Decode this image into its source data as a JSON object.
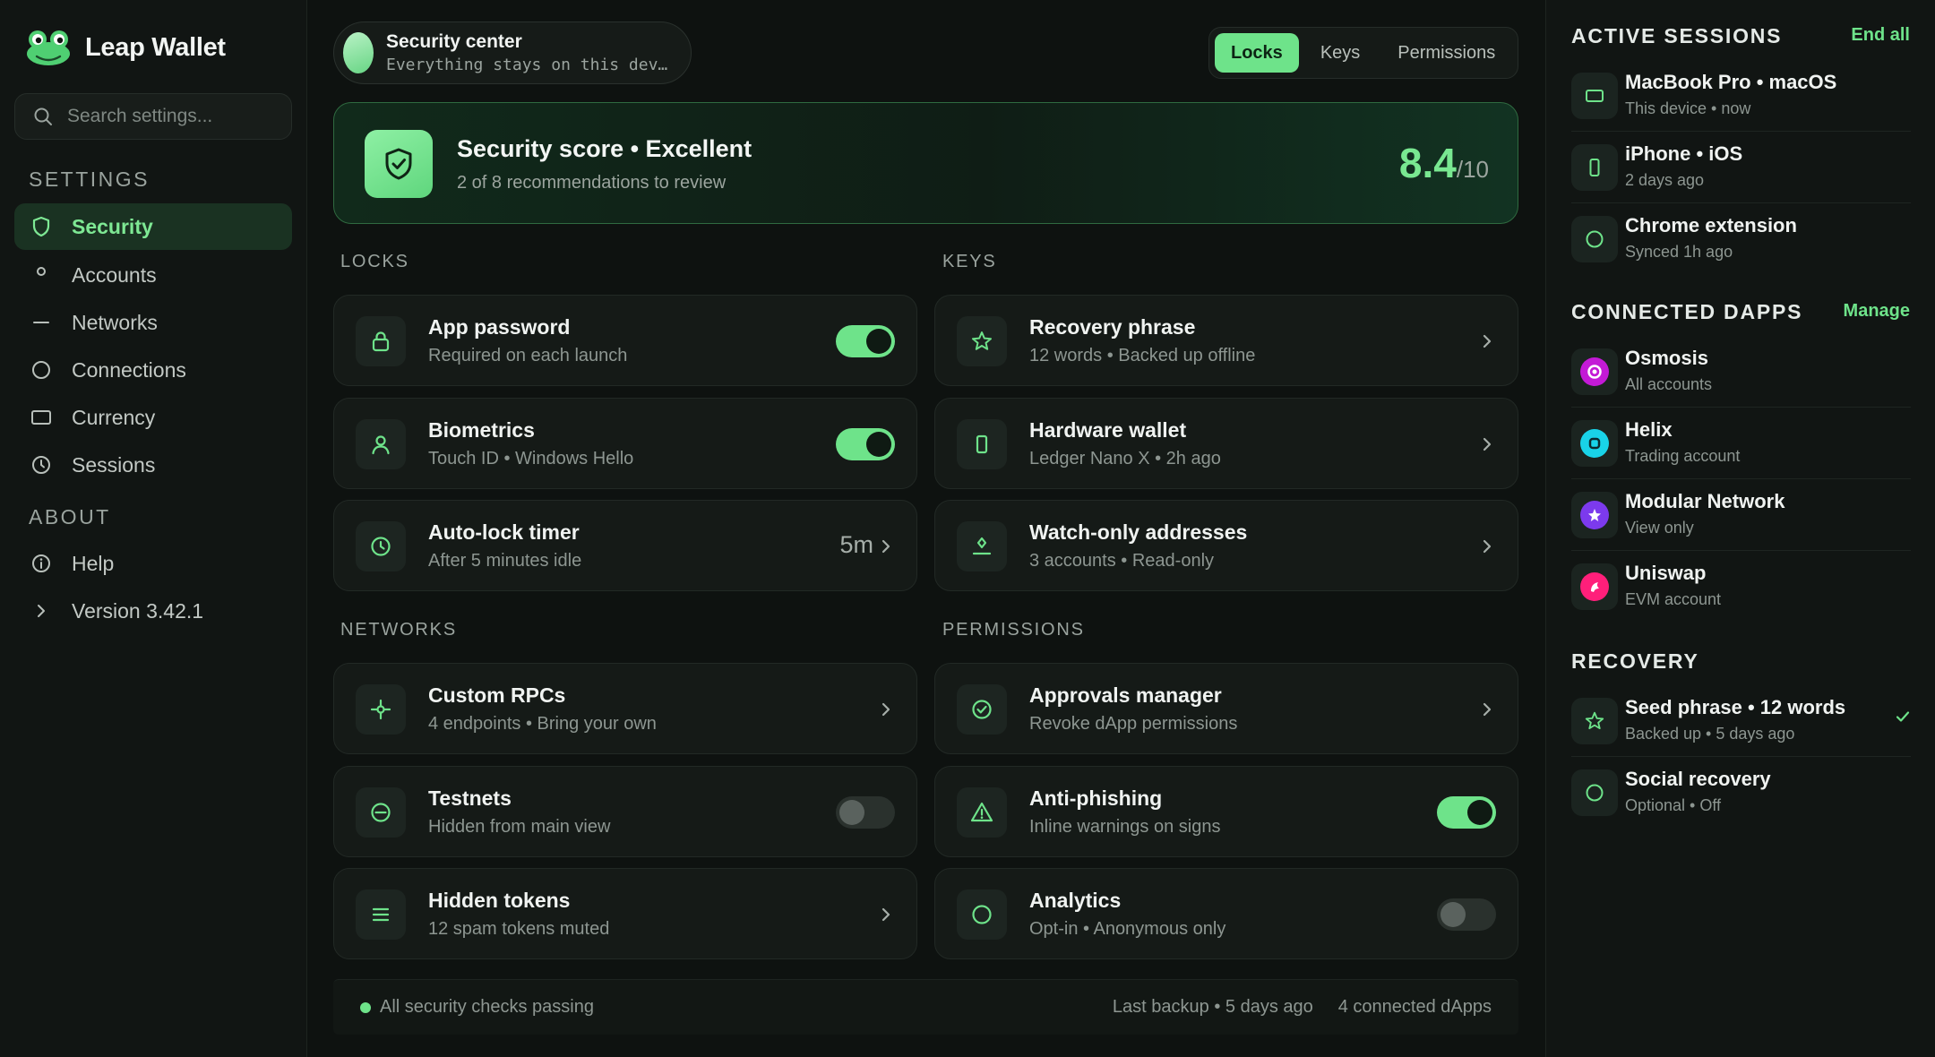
{
  "app": {
    "name": "Leap Wallet"
  },
  "search": {
    "placeholder": "Search settings..."
  },
  "sidebar": {
    "settings_label": "SETTINGS",
    "about_label": "ABOUT",
    "settings_items": [
      {
        "label": "Security",
        "icon": "shield-icon"
      },
      {
        "label": "Accounts",
        "icon": "dot-icon"
      },
      {
        "label": "Networks",
        "icon": "dash-icon"
      },
      {
        "label": "Connections",
        "icon": "circle-icon"
      },
      {
        "label": "Currency",
        "icon": "rect-icon"
      },
      {
        "label": "Sessions",
        "icon": "clock-icon"
      }
    ],
    "about_items": [
      {
        "label": "Help",
        "icon": "info-icon"
      },
      {
        "label": "Version 3.42.1",
        "icon": "chevron-right-icon"
      }
    ]
  },
  "header": {
    "title": "Security center",
    "subtitle": "Everything stays on this dev…",
    "tabs": [
      "Locks",
      "Keys",
      "Permissions"
    ],
    "active_tab": "Locks"
  },
  "score": {
    "title": "Security score • Excellent",
    "subtitle": "2 of 8 recommendations to review",
    "value": "8.4",
    "max": "/10"
  },
  "sections": {
    "locks": "LOCKS",
    "keys": "KEYS",
    "networks": "NETWORKS",
    "permissions": "PERMISSIONS"
  },
  "locks": [
    {
      "title": "App password",
      "subtitle": "Required on each launch",
      "control": "toggle",
      "on": true
    },
    {
      "title": "Biometrics",
      "subtitle": "Touch ID • Windows Hello",
      "control": "toggle",
      "on": true
    },
    {
      "title": "Auto-lock timer",
      "subtitle": "After 5 minutes idle",
      "control": "value",
      "value": "5m"
    }
  ],
  "keys": [
    {
      "title": "Recovery phrase",
      "subtitle": "12 words • Backed up offline"
    },
    {
      "title": "Hardware wallet",
      "subtitle": "Ledger Nano X • 2h ago"
    },
    {
      "title": "Watch-only addresses",
      "subtitle": "3 accounts • Read-only"
    }
  ],
  "networks": [
    {
      "title": "Custom RPCs",
      "subtitle": "4 endpoints • Bring your own",
      "control": "chevron"
    },
    {
      "title": "Testnets",
      "subtitle": "Hidden from main view",
      "control": "toggle",
      "on": false
    },
    {
      "title": "Hidden tokens",
      "subtitle": "12 spam tokens muted",
      "control": "chevron"
    }
  ],
  "permissions": [
    {
      "title": "Approvals manager",
      "subtitle": "Revoke dApp permissions",
      "control": "chevron"
    },
    {
      "title": "Anti-phishing",
      "subtitle": "Inline warnings on signs",
      "control": "toggle",
      "on": true
    },
    {
      "title": "Analytics",
      "subtitle": "Opt-in • Anonymous only",
      "control": "toggle",
      "on": false
    }
  ],
  "footer": {
    "status": "All security checks passing",
    "backup": "Last backup • 5 days ago",
    "dapps": "4 connected dApps"
  },
  "right": {
    "sessions_title": "ACTIVE SESSIONS",
    "sessions_action": "End all",
    "sessions": [
      {
        "title": "MacBook Pro • macOS",
        "subtitle": "This device • now"
      },
      {
        "title": "iPhone • iOS",
        "subtitle": "2 days ago"
      },
      {
        "title": "Chrome extension",
        "subtitle": "Synced 1h ago"
      }
    ],
    "dapps_title": "CONNECTED DAPPS",
    "dapps_action": "Manage",
    "dapps": [
      {
        "title": "Osmosis",
        "subtitle": "All accounts",
        "color": "#c31ad6"
      },
      {
        "title": "Helix",
        "subtitle": "Trading account",
        "color": "#19d3e8"
      },
      {
        "title": "Modular Network",
        "subtitle": "View only",
        "color": "#7c3aed"
      },
      {
        "title": "Uniswap",
        "subtitle": "EVM account",
        "color": "#ff1f7a"
      }
    ],
    "recovery_title": "RECOVERY",
    "recovery": [
      {
        "title": "Seed phrase • 12 words",
        "subtitle": "Backed up • 5 days ago"
      },
      {
        "title": "Social recovery",
        "subtitle": "Optional • Off"
      }
    ]
  },
  "colors": {
    "accent": "#6ee38a",
    "background": "#0e1210",
    "card": "#151a17"
  }
}
